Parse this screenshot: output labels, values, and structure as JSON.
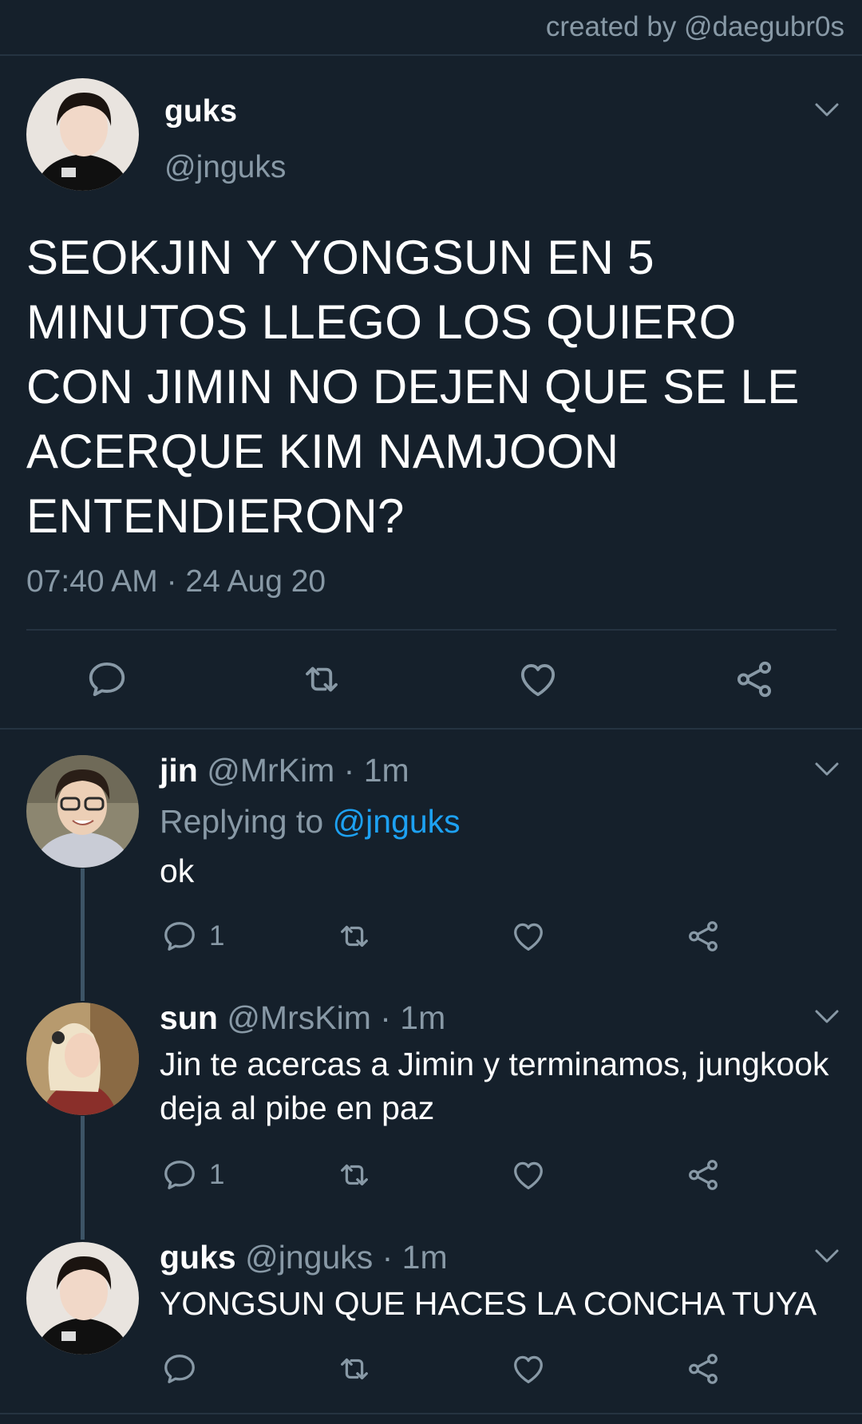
{
  "credit": "created by @daegubr0s",
  "main_tweet": {
    "name": "guks",
    "handle": "@jnguks",
    "text": "SEOKJIN Y YONGSUN EN 5 MINUTOS LLEGO LOS QUIERO CON JIMIN NO DEJEN QUE SE LE ACERQUE KIM NAMJOON ENTENDIERON?",
    "timestamp": "07:40 AM · 24 Aug 20",
    "actions": [
      "reply-icon",
      "retweet-icon",
      "like-icon",
      "share-icon"
    ]
  },
  "replies": [
    {
      "name": "jin",
      "meta": "@MrKim · 1m",
      "replying_label": "Replying to",
      "replying_handle": "@jnguks",
      "text": "ok",
      "reply_count": "1"
    },
    {
      "name": "sun",
      "meta": "@MrsKim · 1m",
      "text": "Jin te acercas a Jimin y terminamos, jungkook deja al pibe en paz",
      "reply_count": "1"
    },
    {
      "name": "guks",
      "meta": "@jnguks · 1m",
      "text": "YONGSUN QUE HACES LA CONCHA TUYA",
      "reply_count": ""
    }
  ],
  "colors": {
    "background": "#15202b",
    "secondary_text": "#8899a6",
    "link": "#1da1f2",
    "separator": "#253341"
  }
}
